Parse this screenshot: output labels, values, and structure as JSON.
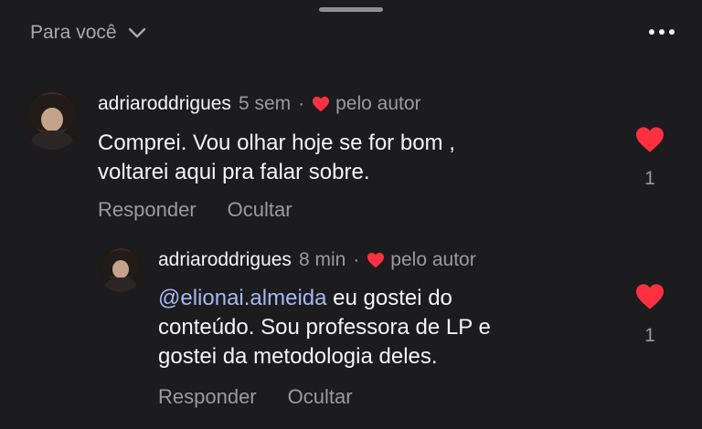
{
  "header": {
    "filter_label": "Para você"
  },
  "comments": [
    {
      "username": "adriaroddrigues",
      "time": "5 sem",
      "separator": "·",
      "liked_by_author": "pelo autor",
      "text": "Comprei. Vou olhar hoje se for bom , voltarei aqui pra falar sobre.",
      "text_line1": "Comprei. Vou olhar hoje se for bom ,",
      "text_line2": "voltarei aqui pra falar sobre.",
      "reply_label": "Responder",
      "hide_label": "Ocultar",
      "like_count": "1"
    },
    {
      "username": "adriaroddrigues",
      "time": "8 min",
      "separator": "·",
      "liked_by_author": "pelo autor",
      "mention": "@elionai.almeida",
      "text_line1_rest": " eu gostei do",
      "text_line2": "conteúdo. Sou professora de LP e",
      "text_line3": "gostei da metodologia deles.",
      "reply_label": "Responder",
      "hide_label": "Ocultar",
      "like_count": "1"
    }
  ],
  "colors": {
    "background": "#1c1c1f",
    "heart": "#ff3040",
    "mention": "#a8b8f0",
    "secondary_text": "#9a9aa0"
  }
}
